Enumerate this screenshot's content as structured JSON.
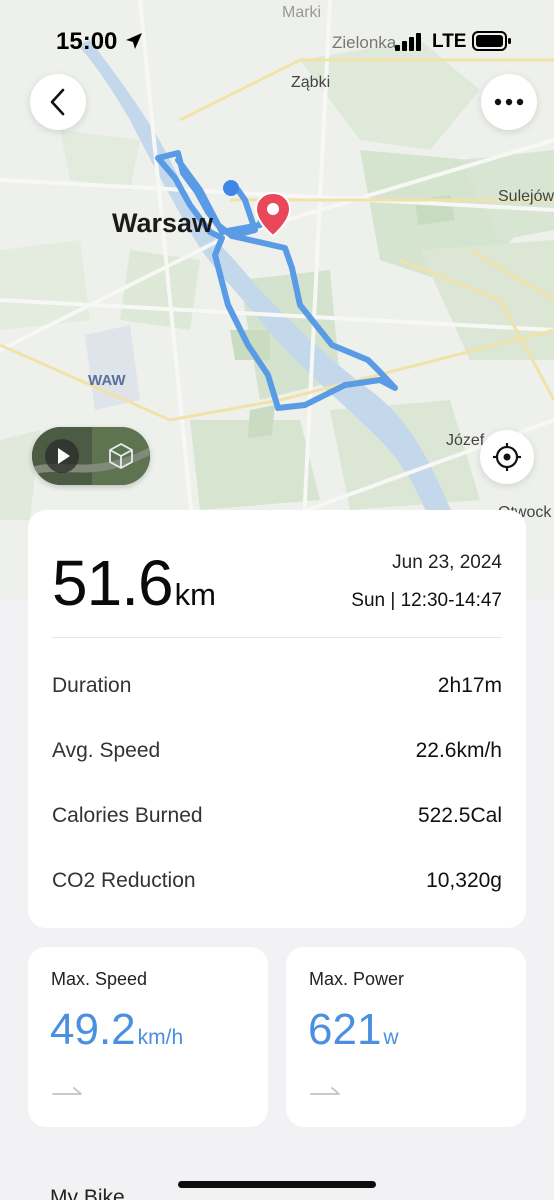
{
  "status_bar": {
    "time": "15:00",
    "carrier_label": "Zielonka",
    "network": "LTE"
  },
  "map": {
    "labels": {
      "marki": "Marki",
      "zabki": "Ząbki",
      "warsaw": "Warsaw",
      "sulejow": "Sulejów",
      "waw": "WAW",
      "jozef": "Józef",
      "otwock": "Otwock"
    },
    "route_color": "#5a9be6",
    "end_marker_color": "#e9475a",
    "start_marker_color": "#3f86e6"
  },
  "summary": {
    "distance_value": "51.6",
    "distance_unit": "km",
    "date": "Jun 23, 2024",
    "day_time": "Sun | 12:30-14:47",
    "stats": [
      {
        "label": "Duration",
        "value": "2h17m"
      },
      {
        "label": "Avg. Speed",
        "value": "22.6km/h"
      },
      {
        "label": "Calories Burned",
        "value": "522.5Cal"
      },
      {
        "label": "CO2 Reduction",
        "value": "10,320g"
      }
    ]
  },
  "max_speed": {
    "title": "Max. Speed",
    "value": "49.2",
    "unit": "km/h"
  },
  "max_power": {
    "title": "Max. Power",
    "value": "621",
    "unit": "w"
  },
  "next_section": "My Bike",
  "accent_color": "#4a8fe0",
  "icons": {
    "back": "chevron-left-icon",
    "more": "more-horizontal-icon",
    "locate": "crosshair-icon",
    "play": "play-icon",
    "cube": "3d-cube-icon",
    "trend": "trend-arrow-icon"
  }
}
